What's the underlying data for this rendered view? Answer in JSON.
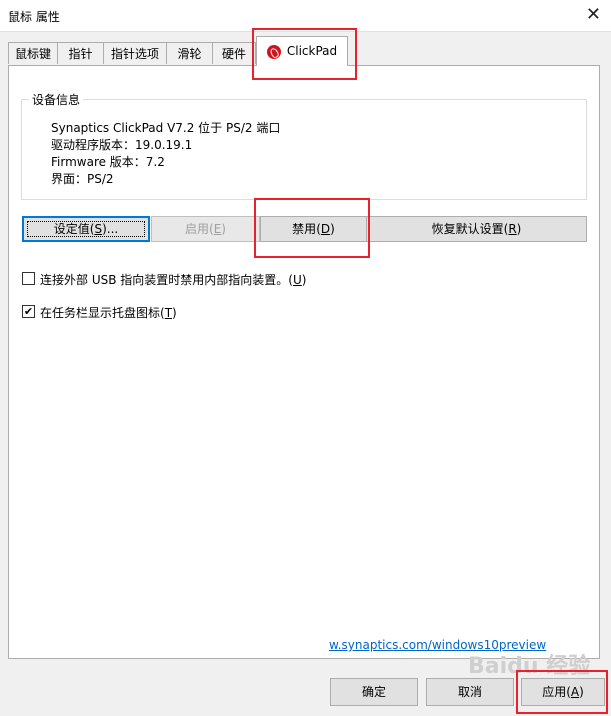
{
  "window": {
    "title": "鼠标 属性",
    "close_glyph": "✕"
  },
  "tabs": [
    {
      "label": "鼠标键"
    },
    {
      "label": "指针"
    },
    {
      "label": "指针选项"
    },
    {
      "label": "滑轮"
    },
    {
      "label": "硬件"
    },
    {
      "label": "ClickPad",
      "active": true
    }
  ],
  "device_info": {
    "legend": "设备信息",
    "lines": [
      "Synaptics ClickPad V7.2 位于 PS/2 端口",
      "驱动程序版本：19.0.19.1",
      "Firmware 版本：7.2",
      "界面：PS/2"
    ]
  },
  "buttons": {
    "settings": {
      "text": "设定值",
      "mnemonic": "S",
      "suffix": "..."
    },
    "enable": {
      "text": "启用",
      "mnemonic": "E",
      "disabled": true
    },
    "disable": {
      "text": "禁用",
      "mnemonic": "D"
    },
    "restore": {
      "text": "恢复默认设置",
      "mnemonic": "R"
    }
  },
  "options": [
    {
      "label": "连接外部 USB 指向装置时禁用内部指向装置。",
      "mnemonic": "U",
      "checked": false
    },
    {
      "label": "在任务栏显示托盘图标",
      "mnemonic": "T",
      "checked": true
    }
  ],
  "link": "w.synaptics.com/windows10preview",
  "footer": {
    "ok": "确定",
    "cancel": "取消",
    "apply": {
      "text": "应用",
      "mnemonic": "A"
    }
  },
  "watermark": "Baidu 经验",
  "colors": {
    "highlight": "#e8212a",
    "link": "#0066cc",
    "focus_border": "#0078d7",
    "clickpad_icon": "#d0141b"
  },
  "icons": {
    "clickpad_tab": "synaptics-logo-icon",
    "check": "checkmark-icon",
    "close": "close-icon"
  }
}
